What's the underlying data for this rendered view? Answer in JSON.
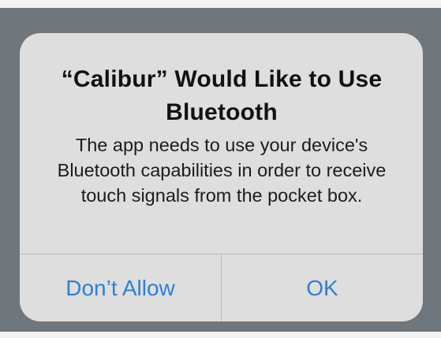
{
  "alert": {
    "title": "“Calibur” Would Like to Use Bluetooth",
    "message": "The app needs to use your device's Bluetooth capabilities in order to receive touch signals from the pocket box.",
    "buttons": {
      "dont_allow": "Don’t Allow",
      "ok": "OK"
    }
  },
  "colors": {
    "button_text": "#2f7fd6",
    "alert_background": "#dedede",
    "backdrop": "#6f767c"
  }
}
